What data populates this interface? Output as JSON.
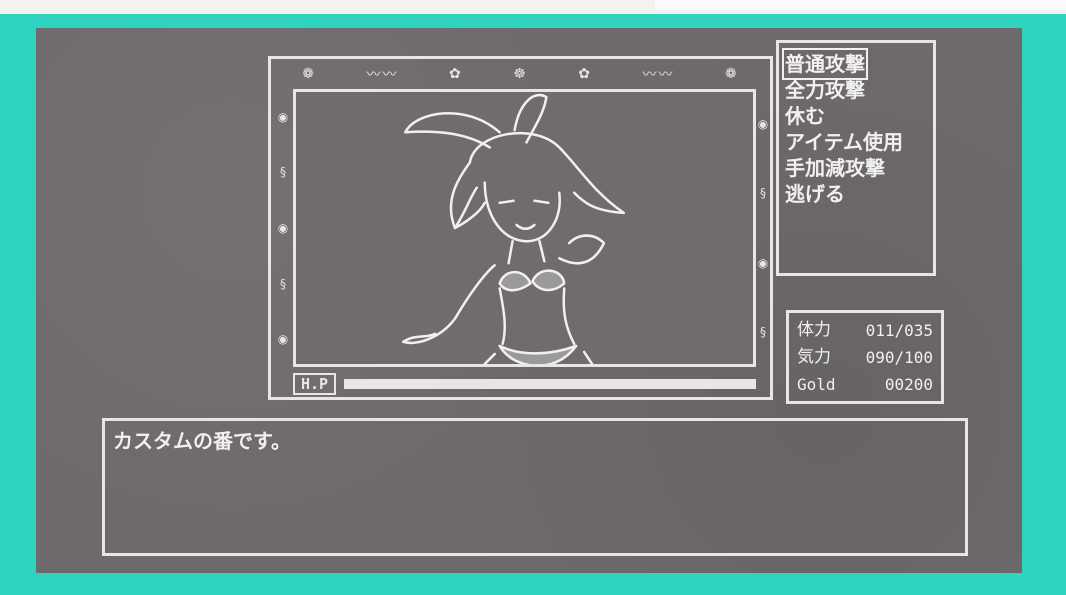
{
  "scene": {
    "hp_label": "H.P",
    "enemy_hp_fraction": 1.0
  },
  "menu": {
    "items": [
      {
        "label": "普通攻撃",
        "selected": true
      },
      {
        "label": "全力攻撃",
        "selected": false
      },
      {
        "label": "休む",
        "selected": false
      },
      {
        "label": "アイテム使用",
        "selected": false
      },
      {
        "label": "手加減攻撃",
        "selected": false
      },
      {
        "label": "逃げる",
        "selected": false
      }
    ]
  },
  "status": {
    "hp_label": "体力",
    "hp_value": "011/035",
    "mp_label": "気力",
    "mp_value": "090/100",
    "gold_label": "Gold",
    "gold_value": "00200"
  },
  "message": {
    "text": "カスタムの番です。"
  },
  "colors": {
    "border": "#2fd3c0",
    "screen": "#6d696c",
    "ink": "#f2f0ee"
  }
}
